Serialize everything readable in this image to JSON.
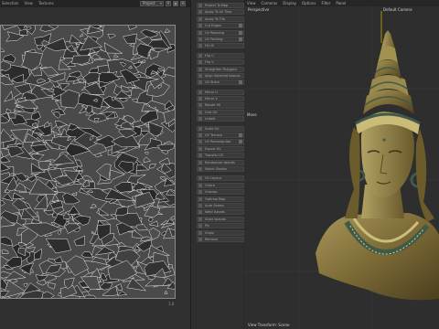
{
  "uv_editor": {
    "menu": [
      "Selection",
      "View",
      "Textures"
    ],
    "dropdown": "Project",
    "toolbar_icons": [
      "grid-icon",
      "checker-icon",
      "settings-icon"
    ],
    "scale_label": "1,0"
  },
  "tools": {
    "group1": [
      {
        "label": "Project To Map",
        "icon": "project-icon",
        "badge": false
      },
      {
        "label": "Apply To All Tiles",
        "icon": "tile-icon",
        "badge": false
      },
      {
        "label": "Apply To Tile",
        "icon": "tile-icon",
        "badge": false
      },
      {
        "label": "Cut Edges",
        "icon": "cut-icon",
        "badge": true
      },
      {
        "label": "UV Relaxing",
        "icon": "relax-icon",
        "badge": true
      },
      {
        "label": "UV Packing",
        "icon": "pack-icon",
        "badge": true
      },
      {
        "label": "Fit UV",
        "icon": "fit-icon",
        "badge": false
      }
    ],
    "group2": [
      {
        "label": "Flip U",
        "icon": "flip-icon",
        "badge": false
      },
      {
        "label": "Flip V",
        "icon": "flip-icon",
        "badge": false
      },
      {
        "label": "Straighten Polygons",
        "icon": "straighten-icon",
        "badge": false
      },
      {
        "label": "Align Selected Islands",
        "icon": "align-icon",
        "badge": false
      },
      {
        "label": "UV Stitch",
        "icon": "stitch-icon",
        "badge": true
      }
    ],
    "group3": [
      {
        "label": "Mirror U",
        "icon": "mirror-icon",
        "badge": false
      },
      {
        "label": "Mirror V",
        "icon": "mirror-icon",
        "badge": false
      },
      {
        "label": "Rotate 90",
        "icon": "rotate-icon",
        "badge": false
      },
      {
        "label": "Grid UV",
        "icon": "grid-icon",
        "badge": false
      },
      {
        "label": "Unfold",
        "icon": "unfold-icon",
        "badge": false
      }
    ],
    "group4": [
      {
        "label": "Scale UV",
        "icon": "scale-icon",
        "badge": false
      },
      {
        "label": "UV Terrace",
        "icon": "terrace-icon",
        "badge": true
      },
      {
        "label": "UV Rectangulize",
        "icon": "rect-icon",
        "badge": true
      },
      {
        "label": "Export UV",
        "icon": "export-icon",
        "badge": false
      },
      {
        "label": "Transfer UV",
        "icon": "transfer-icon",
        "badge": false
      },
      {
        "label": "Randomize Islands",
        "icon": "random-icon",
        "badge": false
      },
      {
        "label": "Select Similar",
        "icon": "select-icon",
        "badge": false
      }
    ],
    "group5": [
      {
        "label": "UV Layout",
        "icon": "layout-icon",
        "badge": false
      },
      {
        "label": "Orient",
        "icon": "orient-icon",
        "badge": false
      },
      {
        "label": "Unwrap",
        "icon": "unwrap-icon",
        "badge": false
      },
      {
        "label": "Optimal Map",
        "icon": "map-icon",
        "badge": false
      },
      {
        "label": "Auto Seams",
        "icon": "seam-icon",
        "badge": false
      },
      {
        "label": "Weld Islands",
        "icon": "weld-icon",
        "badge": false
      },
      {
        "label": "Scale Islands",
        "icon": "scale-icon",
        "badge": false
      },
      {
        "label": "Pin",
        "icon": "pin-icon",
        "badge": false
      },
      {
        "label": "Unpin",
        "icon": "pin-icon",
        "badge": false
      },
      {
        "label": "Remove",
        "icon": "remove-icon",
        "badge": false
      }
    ]
  },
  "viewport": {
    "menu": [
      "View",
      "Cameras",
      "Display",
      "Options",
      "Filter",
      "Panel"
    ],
    "projection": "Perspective",
    "camera": "Default Camera",
    "axis_tag": "Move",
    "status": "View Transform: Scene",
    "model_color": "#8a7a44"
  }
}
